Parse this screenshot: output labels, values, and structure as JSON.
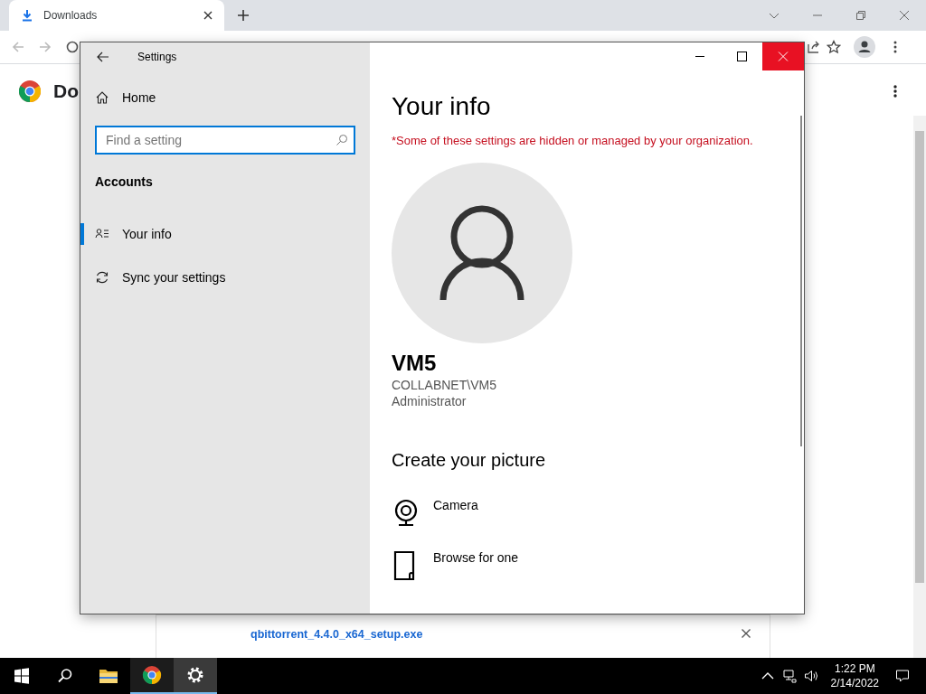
{
  "browser": {
    "tab": {
      "title": "Downloads",
      "selected": true
    },
    "page_heading": "Do",
    "download": {
      "filename": "qbittorrent_4.4.0_x64_setup.exe"
    }
  },
  "settings": {
    "title": "Settings",
    "home": "Home",
    "search": {
      "placeholder": "Find a setting"
    },
    "section": "Accounts",
    "nav_items": [
      {
        "label": "Your info",
        "kind": "info",
        "selected": true
      },
      {
        "label": "Sync your settings",
        "kind": "sync",
        "selected": false
      }
    ],
    "heading": "Your info",
    "notice": "*Some of these settings are hidden or managed by your organization.",
    "user": {
      "name": "VM5",
      "account": "COLLABNET\\VM5",
      "role": "Administrator"
    },
    "picture_section": "Create your picture",
    "picture_options": [
      {
        "label": "Camera",
        "kind": "camera"
      },
      {
        "label": "Browse for one",
        "kind": "browse"
      }
    ]
  },
  "taskbar": {
    "apps": [
      {
        "kind": "explorer",
        "open": false,
        "selected": false
      },
      {
        "kind": "chrome",
        "open": true,
        "selected": false
      },
      {
        "kind": "settings",
        "open": true,
        "selected": true
      }
    ],
    "time": "1:22 PM",
    "date": "2/14/2022"
  }
}
